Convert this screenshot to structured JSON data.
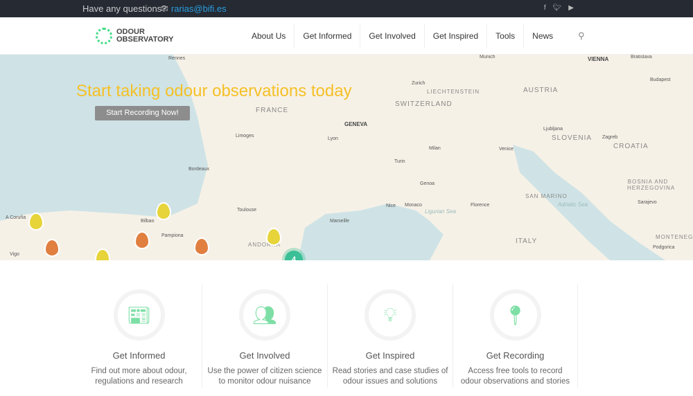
{
  "topbar": {
    "question": "Have any questions?",
    "email": "rarias@bifi.es",
    "mail_icon": "envelope-icon",
    "social": [
      "facebook-icon",
      "twitter-icon",
      "youtube-icon"
    ]
  },
  "header": {
    "logo_line1": "ODOUR",
    "logo_line2": "OBSERVATORY",
    "nav": [
      "About Us",
      "Get Informed",
      "Get Involved",
      "Get Inspired",
      "Tools",
      "News"
    ],
    "search_icon": "search-icon"
  },
  "hero": {
    "title": "Start taking odour observations today",
    "button": "Start Recording Now!",
    "title_color": "#f5c026"
  },
  "map": {
    "labels": [
      "Rennes",
      "Munich",
      "VIENNA",
      "Bratislava",
      "Zurich",
      "LIECHTENSTEIN",
      "AUSTRIA",
      "Budapest",
      "FRANCE",
      "SWITZERLAND",
      "GENEVA",
      "Limoges",
      "Lyon",
      "Ljubljana",
      "Zagreb",
      "SLOVENIA",
      "CROATIA",
      "Milan",
      "Venice",
      "Turin",
      "Bordeaux",
      "Genoa",
      "BOSNIA AND HERZEGOVINA",
      "Sarajevo",
      "SAN MARINO",
      "Nice",
      "Monaco",
      "Florence",
      "Toulouse",
      "Marseille",
      "Ligurian Sea",
      "Adriatic Sea",
      "A Coruña",
      "Bilbao",
      "Pampiona",
      "ANDORRA",
      "Vigo",
      "ITALY",
      "MONTENEG",
      "Podgorica"
    ],
    "cluster_count": "4",
    "pin_colors": {
      "yellow": "#e6d43a",
      "orange": "#e07f40"
    }
  },
  "features": [
    {
      "title": "Get Informed",
      "text1": "Find out more about odour,",
      "text2": "regulations and research",
      "icon": "newspaper-icon"
    },
    {
      "title": "Get Involved",
      "text1": "Use the power of citizen science",
      "text2": "to monitor odour nuisance",
      "icon": "users-icon"
    },
    {
      "title": "Get Inspired",
      "text1": "Read stories and case studies of",
      "text2": "odour issues and solutions",
      "icon": "lightbulb-icon"
    },
    {
      "title": "Get Recording",
      "text1": "Access free tools to record",
      "text2": "odour observations and stories",
      "icon": "map-pin-icon"
    }
  ]
}
